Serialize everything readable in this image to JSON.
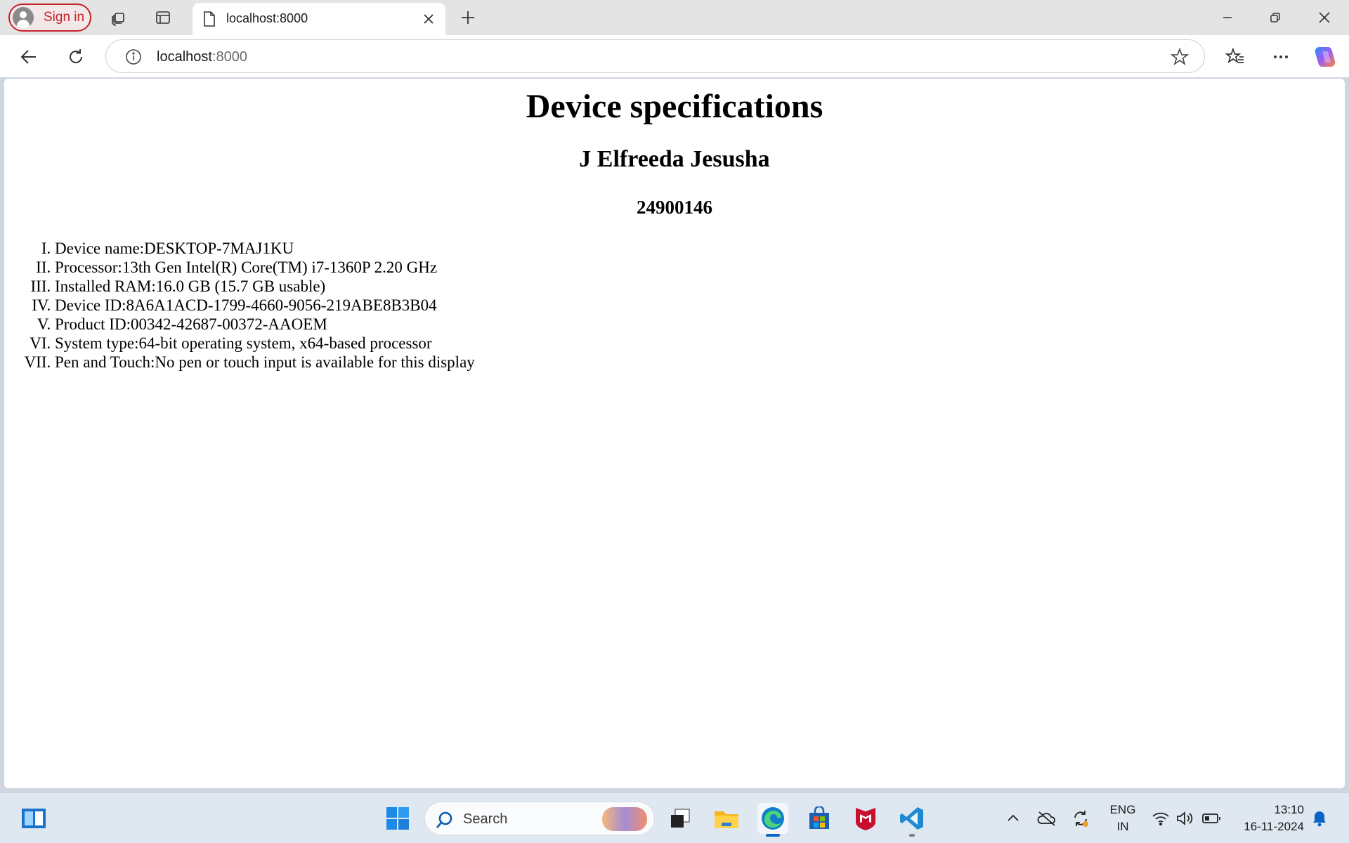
{
  "browser": {
    "signin_label": "Sign in",
    "tab_title": "localhost:8000",
    "address": {
      "host": "localhost",
      "port": ":8000"
    },
    "icons": {
      "workspaces": "workspaces-icon",
      "tab_actions": "tab-actions-icon",
      "page": "page-icon",
      "close_tab": "close-icon",
      "new_tab": "plus-icon",
      "minimize": "minimize-icon",
      "restore": "restore-icon",
      "close_window": "close-icon",
      "back": "back-arrow-icon",
      "refresh": "refresh-icon",
      "site_info": "info-icon",
      "favorite": "star-icon",
      "favorites": "favorites-icon",
      "more": "more-icon",
      "copilot": "copilot-icon"
    }
  },
  "page": {
    "title": "Device specifications",
    "name": "J Elfreeda Jesusha",
    "id": "24900146",
    "specs": [
      "Device name:DESKTOP-7MAJ1KU",
      "Processor:13th Gen Intel(R) Core(TM) i7-1360P 2.20 GHz",
      "Installed RAM:16.0 GB (15.7 GB usable)",
      "Device ID:8A6A1ACD-1799-4660-9056-219ABE8B3B04",
      "Product ID:00342-42687-00372-AAOEM",
      "System type:64-bit operating system, x64-based processor",
      "Pen and Touch:No pen or touch input is available for this display"
    ]
  },
  "taskbar": {
    "search_placeholder": "Search",
    "language": {
      "line1": "ENG",
      "line2": "IN"
    },
    "time": "13:10",
    "date": "16-11-2024",
    "apps": [
      "widgets-icon",
      "start-icon",
      "terminal-icon",
      "file-explorer-icon",
      "edge-icon",
      "store-icon",
      "mcafee-icon",
      "vscode-icon"
    ],
    "tray": [
      "chevron-up-icon",
      "onedrive-icon",
      "sync-icon",
      "wifi-icon",
      "volume-icon",
      "battery-icon",
      "notification-bell-icon"
    ]
  },
  "colors": {
    "accent": "#0a64c8",
    "signin_red": "#c4242b",
    "taskbar_bg": "#dfe7f1"
  }
}
